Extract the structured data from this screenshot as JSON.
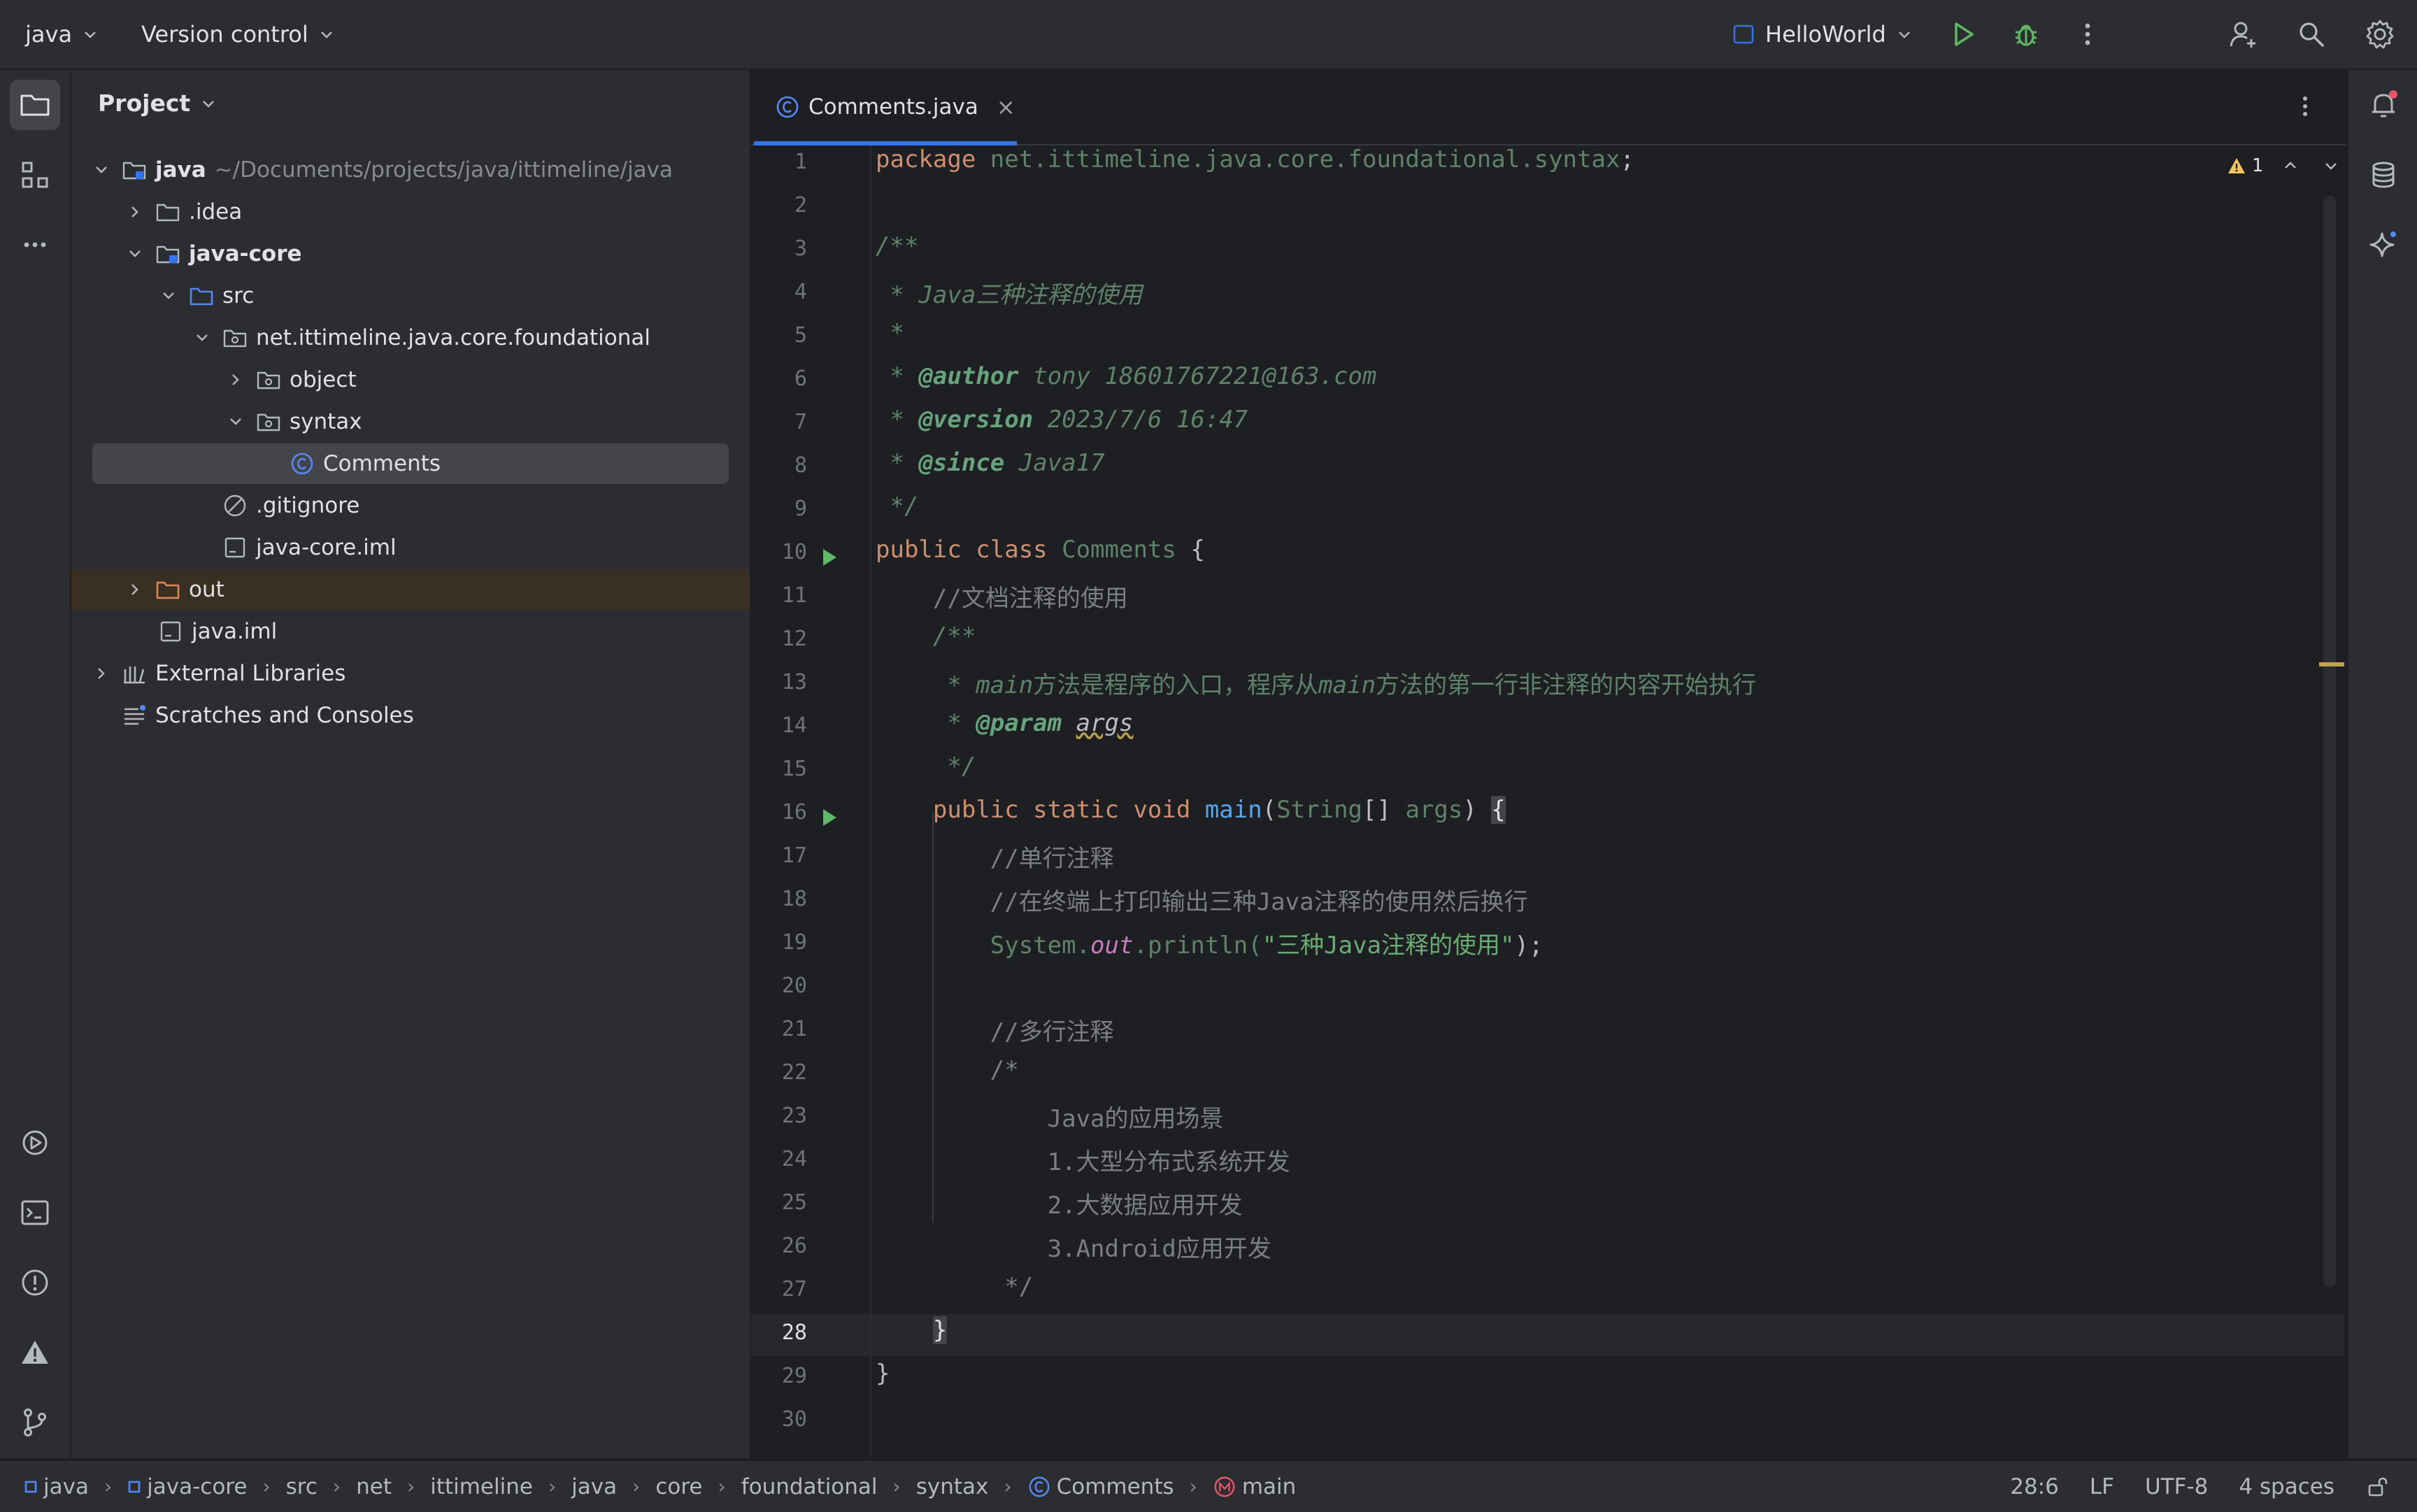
{
  "titlebar": {
    "project_name": "java",
    "vcs_label": "Version control",
    "run_config": "HelloWorld"
  },
  "project_panel": {
    "title": "Project",
    "tree": [
      {
        "label": "java",
        "path": "~/Documents/projects/java/ittimeline/java",
        "icon": "module-folder-icon",
        "bold": true
      },
      {
        "label": ".idea",
        "icon": "folder-icon"
      },
      {
        "label": "java-core",
        "icon": "module-folder-icon",
        "bold": true
      },
      {
        "label": "src",
        "icon": "source-folder-icon"
      },
      {
        "label": "net.ittimeline.java.core.foundational",
        "icon": "package-icon"
      },
      {
        "label": "object",
        "icon": "package-icon"
      },
      {
        "label": "syntax",
        "icon": "package-icon"
      },
      {
        "label": "Comments",
        "icon": "class-icon",
        "selected": true
      },
      {
        "label": ".gitignore",
        "icon": "ignore-file-icon"
      },
      {
        "label": "java-core.iml",
        "icon": "iml-file-icon"
      },
      {
        "label": "out",
        "icon": "excluded-folder-icon"
      },
      {
        "label": "java.iml",
        "icon": "iml-file-icon"
      },
      {
        "label": "External Libraries",
        "icon": "library-icon"
      },
      {
        "label": "Scratches and Consoles",
        "icon": "scratches-icon"
      }
    ]
  },
  "editor": {
    "tab_label": "Comments.java",
    "tab_close": "×",
    "warning_count": "1",
    "current_line": "28",
    "line_numbers": [
      "1",
      "2",
      "3",
      "4",
      "5",
      "6",
      "7",
      "8",
      "9",
      "10",
      "11",
      "12",
      "13",
      "14",
      "15",
      "16",
      "17",
      "18",
      "19",
      "20",
      "21",
      "22",
      "23",
      "24",
      "25",
      "26",
      "27",
      "28",
      "29",
      "30"
    ],
    "code": {
      "l1_kw": "package",
      "l1_pkg": " net.ittimeline.java.core.foundational.syntax",
      "l1_end": ";",
      "l3": "/**",
      "l4": " * Java三种注释的使用",
      "l5": " *",
      "l6_pre": " * ",
      "l6_tag": "@author",
      "l6_val": " tony 18601767221@163.com",
      "l7_pre": " * ",
      "l7_tag": "@version",
      "l7_val": " 2023/7/6 16:47",
      "l8_pre": " * ",
      "l8_tag": "@since",
      "l8_val": " Java17",
      "l9": " */",
      "l10_kw": "public class",
      "l10_name": " Comments ",
      "l10_brace": "{",
      "l11": "    //文档注释的使用",
      "l12": "    /**",
      "l13_a": "     * main",
      "l13_b": "方法是程序的入口，程序从",
      "l13_c": "main",
      "l13_d": "方法的第一行非注释的内容开始执行",
      "l14_pre": "     * ",
      "l14_tag": "@param",
      "l14_sp": " ",
      "l14_param": "args",
      "l15": "     */",
      "l16_indent": "    ",
      "l16_kw": "public static void",
      "l16_fn": " main",
      "l16_p1": "(",
      "l16_type": "String",
      "l16_p2": "[] ",
      "l16_arg": "args",
      "l16_p3": ") ",
      "l16_brace": "{",
      "l17": "        //单行注释",
      "l18": "        //在终端上打印输出三种Java注释的使用然后换行",
      "l19_a": "        System.",
      "l19_b": "out",
      "l19_c": ".println(",
      "l19_str": "\"三种Java注释的使用\"",
      "l19_d": ");",
      "l21": "        //多行注释",
      "l22": "        /*",
      "l23": "            Java的应用场景",
      "l24": "            1.大型分布式系统开发",
      "l25": "            2.大数据应用开发",
      "l26": "            3.Android应用开发",
      "l27": "         */",
      "l28_indent": "    ",
      "l28_brace": "}",
      "l29": "}"
    }
  },
  "breadcrumbs": [
    "java",
    "java-core",
    "src",
    "net",
    "ittimeline",
    "java",
    "core",
    "foundational",
    "syntax",
    "Comments",
    "main"
  ],
  "status": {
    "position": "28:6",
    "line_separator": "LF",
    "encoding": "UTF-8",
    "indent": "4 spaces"
  },
  "colors": {
    "accent": "#3574f0",
    "run_green": "#5fb865",
    "notification_dot": "#e55765",
    "warning": "#f2c55c"
  }
}
